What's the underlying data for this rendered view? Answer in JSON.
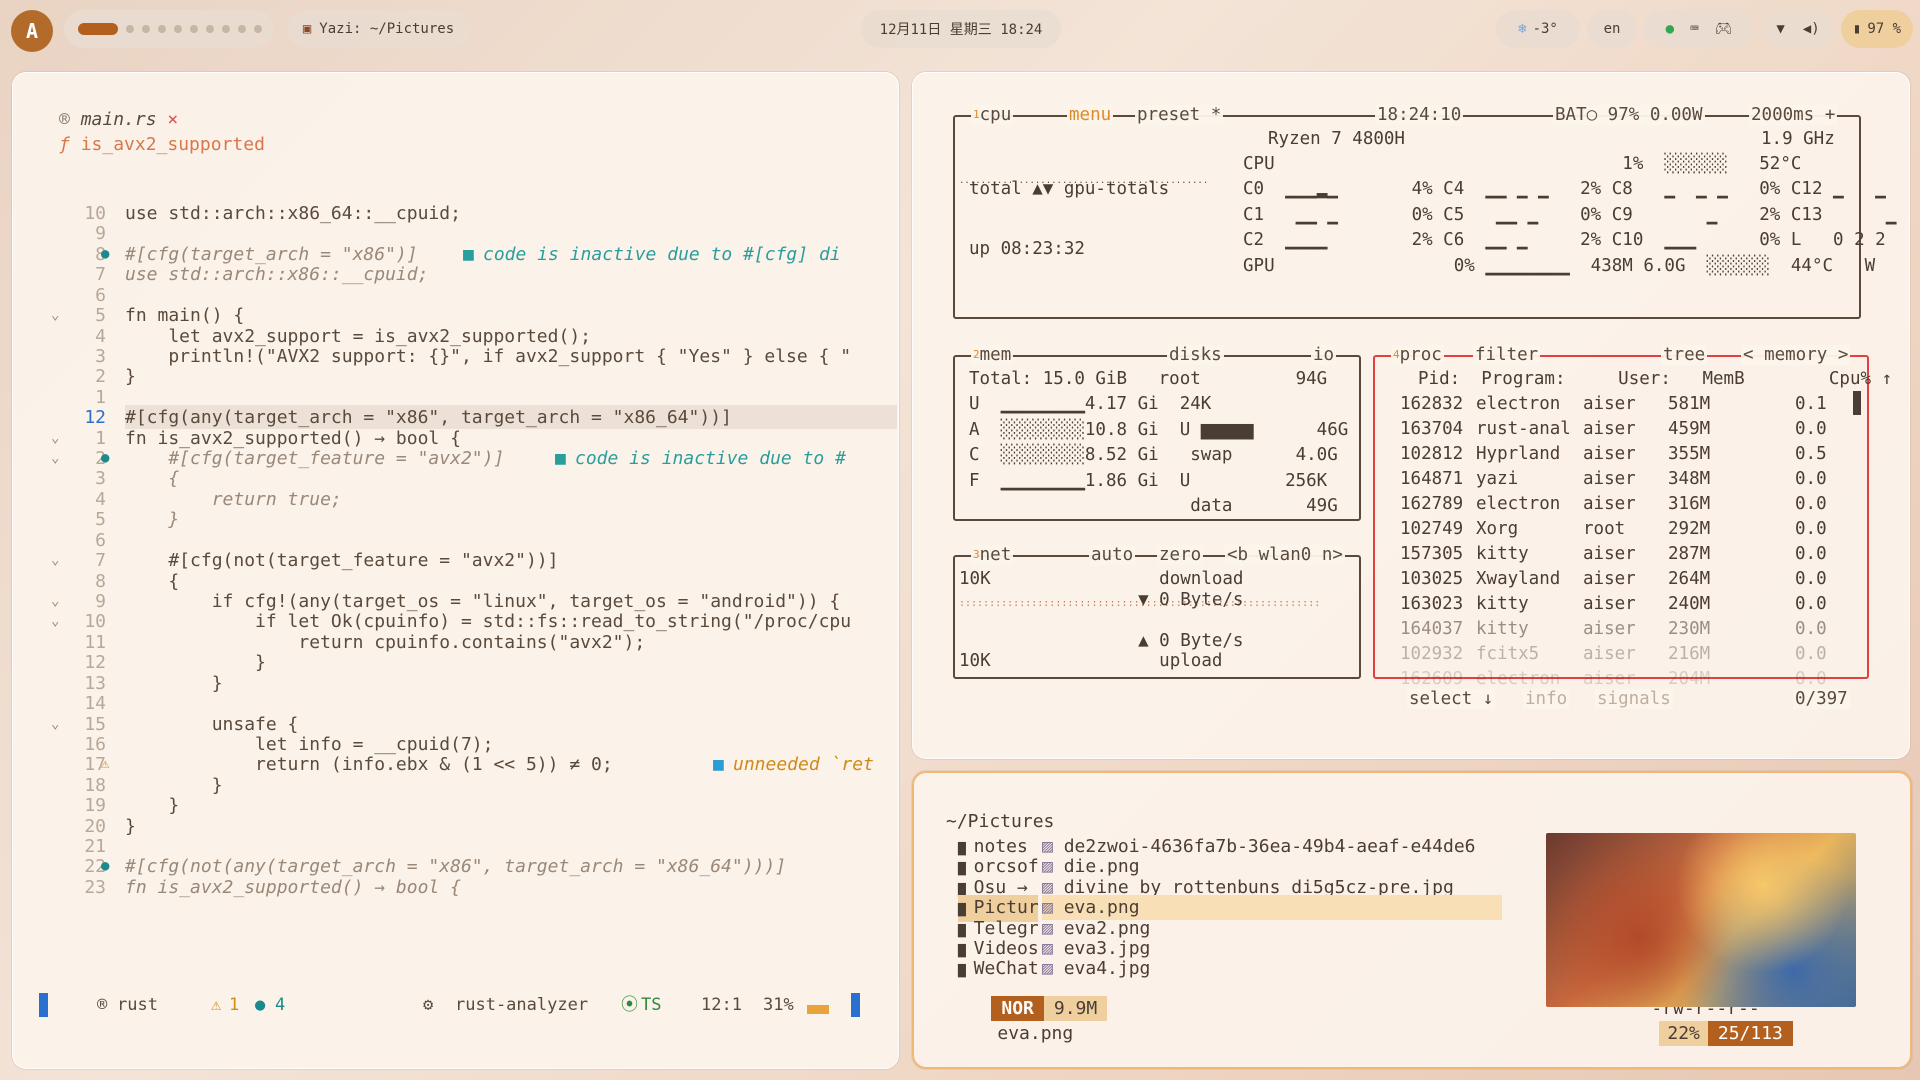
{
  "topbar": {
    "logo": "A",
    "window_title": "Yazi: ~/Pictures",
    "clock": "12月11日  星期三  18:24",
    "weather": "-3°",
    "lang": "en",
    "battery": "97 %"
  },
  "editor": {
    "tab_file": "main.rs",
    "breadcrumb": "is_avx2_supported",
    "lines": [
      {
        "n": "10",
        "t": "use std::arch::x86_64::__cpuid;"
      },
      {
        "n": "9",
        "t": ""
      },
      {
        "n": "8",
        "t": "#[cfg(target_arch = \"x86\")]",
        "hint": "code is inactive due to #[cfg] di"
      },
      {
        "n": "7",
        "t": "use std::arch::x86::__cpuid;"
      },
      {
        "n": "6",
        "t": ""
      },
      {
        "n": "5",
        "t": "fn main() {"
      },
      {
        "n": "4",
        "t": "    let avx2_support = is_avx2_supported();"
      },
      {
        "n": "3",
        "t": "    println!(\"AVX2 support: {}\", if avx2_support { \"Yes\" } else { \""
      },
      {
        "n": "2",
        "t": "}"
      },
      {
        "n": "1",
        "t": ""
      },
      {
        "n": "12",
        "t": "#[cfg(any(target_arch = \"x86\", target_arch = \"x86_64\"))]"
      },
      {
        "n": "1",
        "t": "fn is_avx2_supported() → bool {"
      },
      {
        "n": "2",
        "t": "    #[cfg(target_feature = \"avx2\")]",
        "hint": "code is inactive due to #"
      },
      {
        "n": "3",
        "t": "    {"
      },
      {
        "n": "4",
        "t": "        return true;"
      },
      {
        "n": "5",
        "t": "    }"
      },
      {
        "n": "6",
        "t": ""
      },
      {
        "n": "7",
        "t": "    #[cfg(not(target_feature = \"avx2\"))]"
      },
      {
        "n": "8",
        "t": "    {"
      },
      {
        "n": "9",
        "t": "        if cfg!(any(target_os = \"linux\", target_os = \"android\")) {"
      },
      {
        "n": "10",
        "t": "            if let Ok(cpuinfo) = std::fs::read_to_string(\"/proc/cpu"
      },
      {
        "n": "11",
        "t": "                return cpuinfo.contains(\"avx2\");"
      },
      {
        "n": "12",
        "t": "            }"
      },
      {
        "n": "13",
        "t": "        }"
      },
      {
        "n": "14",
        "t": ""
      },
      {
        "n": "15",
        "t": "        unsafe {"
      },
      {
        "n": "16",
        "t": "            let info = __cpuid(7);"
      },
      {
        "n": "17",
        "t": "            return (info.ebx & (1 << 5)) ≠ 0;",
        "hint": "unneeded `ret"
      },
      {
        "n": "18",
        "t": "        }"
      },
      {
        "n": "19",
        "t": "    }"
      },
      {
        "n": "20",
        "t": "}"
      },
      {
        "n": "21",
        "t": ""
      },
      {
        "n": "22",
        "t": "#[cfg(not(any(target_arch = \"x86\", target_arch = \"x86_64\")))]"
      },
      {
        "n": "23",
        "t": "fn is_avx2_supported() → bool {"
      }
    ],
    "status": {
      "lang": "rust",
      "warnings": "1",
      "hints": "4",
      "lsp": "rust-analyzer",
      "ts": "TS",
      "pos": "12:1",
      "pct": "31%"
    }
  },
  "btop": {
    "cpu_box": {
      "num": "1",
      "title": "cpu",
      "menu": "menu",
      "preset": "preset *",
      "time": "18:24:10",
      "bat": "BAT○ 97% 0.00W",
      "freq": "2000ms +"
    },
    "cpu_name": "Ryzen 7 4800H",
    "cpu_ghz": "1.9 GHz",
    "cpu_total": "total ▲▼ gpu-totals",
    "uptime": "up 08:23:32",
    "cpu_rows": [
      "CPU                                 1%  ░░░░░░   52°C",
      "C0  ▁▁▁▂▁       4% C4  ▁▁ ▁ ▁   2% C8   ▁  ▁ ▁   0% C12 ▁   ▁   0%",
      "C1   ▁▁ ▁       0% C5   ▁▁ ▁    0% C9       ▁    2% C13      ▁   0%",
      "C2  ▁▁▁▁        2% C6  ▁▁ ▁     2% C10  ▁▁▁      0% L   0 2 2    0%",
      "GPU                 0% ▁▁▁▁▁▁▁▁  438M 6.0G  ░░░░░░  44°C   W"
    ],
    "mem_box": {
      "num": "2",
      "title": "mem",
      "disks": "disks",
      "io": "io"
    },
    "mem_rows": [
      "Total: 15.0 GiB   root         94G",
      "U  ▁▁▁▁▁▁▁▁4.17 Gi  24K",
      "A  ░░░░░░░░10.8 Gi  U ▆▆▆▆▆      46G",
      "C  ░░░░░░░░8.52 Gi   swap      4.0G",
      "F  ▁▁▁▁▁▁▁▁1.86 Gi  U         256K",
      "                     data       49G"
    ],
    "net_box": {
      "num": "3",
      "title": "net",
      "auto": "auto",
      "zero": "zero",
      "iface": "<b wlan0 n>"
    },
    "net_rows": [
      "10K                download",
      "                 ▼ 0 Byte/s",
      "",
      "                 ▲ 0 Byte/s",
      "10K                upload"
    ],
    "proc_box": {
      "num": "4",
      "title": "proc",
      "filter": "filter",
      "tree": "tree",
      "sort": "< memory >"
    },
    "proc_header": "Pid:  Program:     User:   MemB        Cpu% ↑",
    "procs": [
      {
        "pid": "162832",
        "prog": "electron",
        "user": "aiser",
        "mem": "581M",
        "cpu": "0.1"
      },
      {
        "pid": "163704",
        "prog": "rust-anal",
        "user": "aiser",
        "mem": "459M",
        "cpu": "0.0"
      },
      {
        "pid": "102812",
        "prog": "Hyprland",
        "user": "aiser",
        "mem": "355M",
        "cpu": "0.5"
      },
      {
        "pid": "164871",
        "prog": "yazi",
        "user": "aiser",
        "mem": "348M",
        "cpu": "0.0"
      },
      {
        "pid": "162789",
        "prog": "electron",
        "user": "aiser",
        "mem": "316M",
        "cpu": "0.0"
      },
      {
        "pid": "102749",
        "prog": "Xorg",
        "user": "root",
        "mem": "292M",
        "cpu": "0.0"
      },
      {
        "pid": "157305",
        "prog": "kitty",
        "user": "aiser",
        "mem": "287M",
        "cpu": "0.0"
      },
      {
        "pid": "103025",
        "prog": "Xwayland",
        "user": "aiser",
        "mem": "264M",
        "cpu": "0.0"
      },
      {
        "pid": "163023",
        "prog": "kitty",
        "user": "aiser",
        "mem": "240M",
        "cpu": "0.0"
      },
      {
        "pid": "164037",
        "prog": "kitty",
        "user": "aiser",
        "mem": "230M",
        "cpu": "0.0"
      },
      {
        "pid": "102932",
        "prog": "fcitx5",
        "user": "aiser",
        "mem": "216M",
        "cpu": "0.0"
      },
      {
        "pid": "162609",
        "prog": "electron",
        "user": "aiser",
        "mem": "204M",
        "cpu": "0.0"
      }
    ],
    "proc_footer": {
      "select": "select ↓",
      "info": "info",
      "signals": "signals",
      "count": "0/397"
    }
  },
  "yazi": {
    "path": "~/Pictures",
    "parent": [
      "notes",
      "orcsof",
      "Osu →",
      "Pictur",
      "Telegr",
      "Videos",
      "WeChat"
    ],
    "files": [
      "de2zwoi-4636fa7b-36ea-49b4-aeaf-e44de6",
      "die.png",
      "divine_by_rottenbuns_di5g5cz-pre.jpg",
      "eva.png",
      "eva2.png",
      "eva3.jpg",
      "eva4.jpg"
    ],
    "status": {
      "mode": "NOR",
      "size": "9.9M",
      "name": "eva.png",
      "perm": "-rw-r--r--",
      "pct": "22%",
      "pos": "25/113"
    }
  },
  "colors": {
    "accent": "#b3601f",
    "red_box": "#e0413e",
    "yazi_border": "#f0b777"
  }
}
